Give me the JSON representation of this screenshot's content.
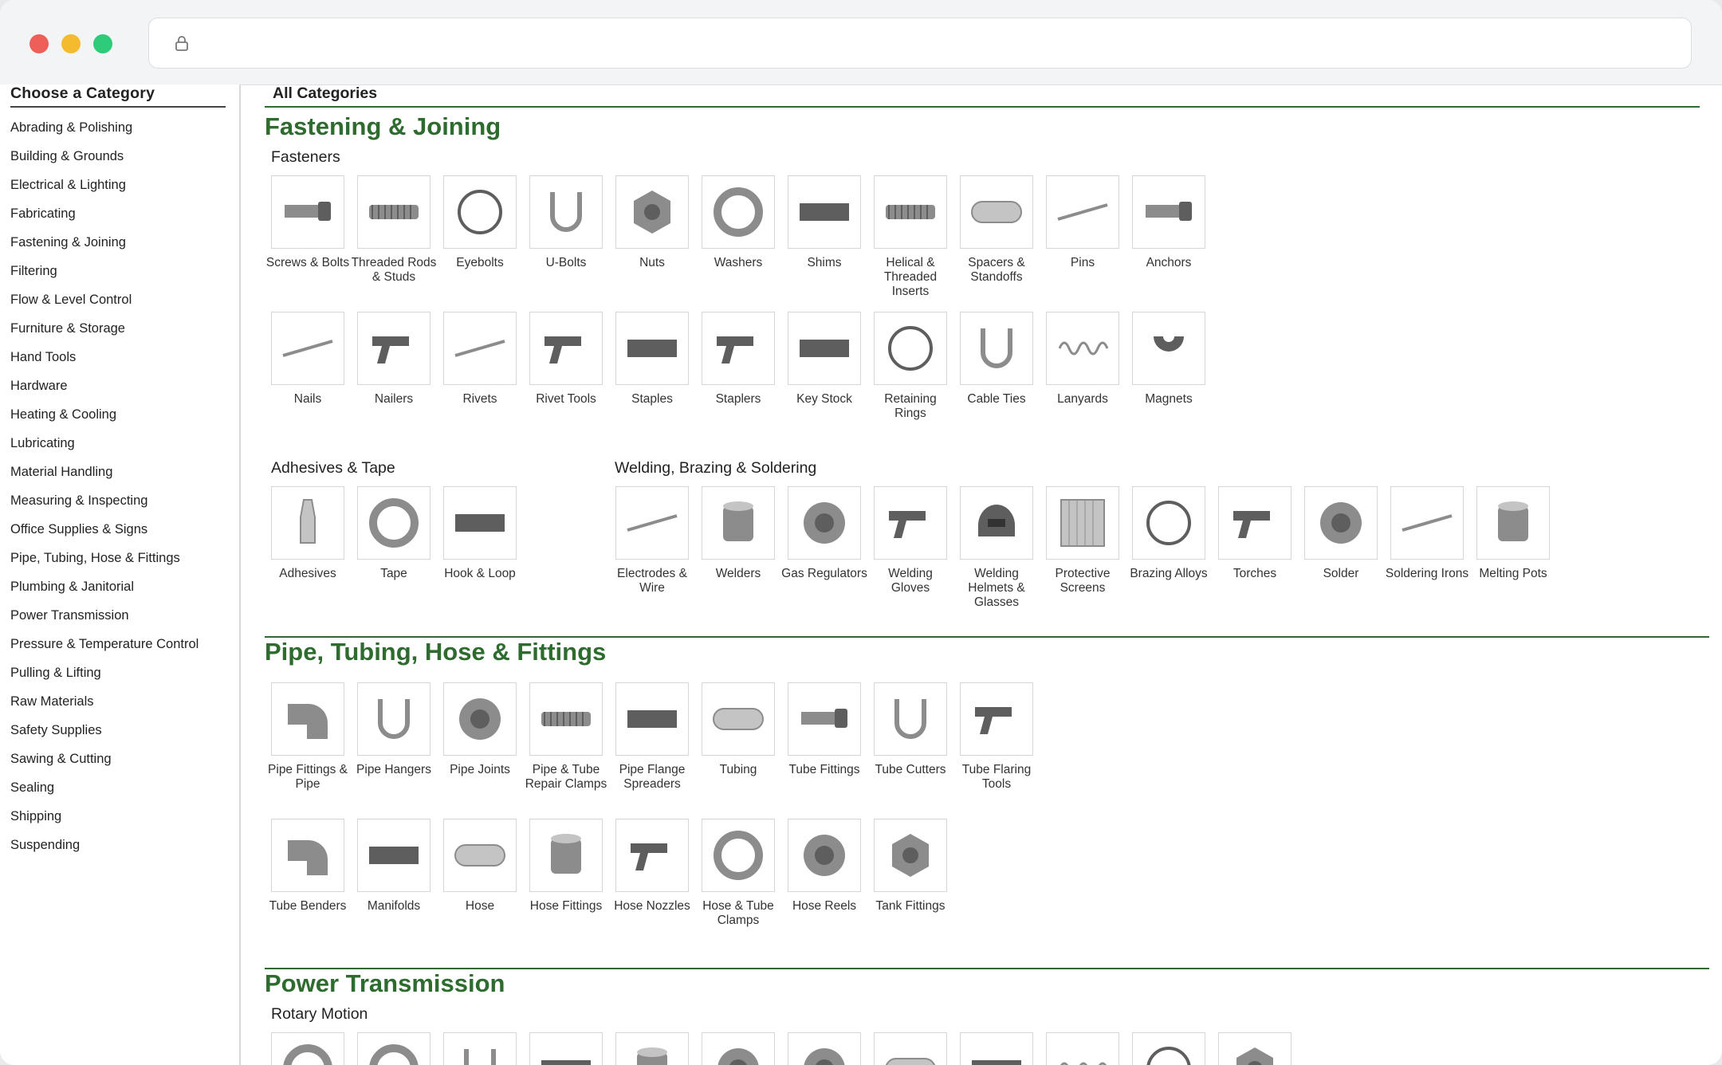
{
  "browser": {
    "url": ""
  },
  "sidebar": {
    "title": "Choose a Category",
    "items": [
      "Abrading & Polishing",
      "Building & Grounds",
      "Electrical & Lighting",
      "Fabricating",
      "Fastening & Joining",
      "Filtering",
      "Flow & Level Control",
      "Furniture & Storage",
      "Hand Tools",
      "Hardware",
      "Heating & Cooling",
      "Lubricating",
      "Material Handling",
      "Measuring & Inspecting",
      "Office Supplies & Signs",
      "Pipe, Tubing, Hose & Fittings",
      "Plumbing & Janitorial",
      "Power Transmission",
      "Pressure & Temperature Control",
      "Pulling & Lifting",
      "Raw Materials",
      "Safety Supplies",
      "Sawing & Cutting",
      "Sealing",
      "Shipping",
      "Suspending"
    ]
  },
  "main": {
    "heading": "All Categories",
    "sections": [
      {
        "title": "Fastening & Joining",
        "groups": [
          {
            "title": "Fasteners",
            "items": [
              {
                "label": "Screws & Bolts",
                "icon": "screw-icon"
              },
              {
                "label": "Threaded Rods & Studs",
                "icon": "threaded-rod-icon"
              },
              {
                "label": "Eyebolts",
                "icon": "eyebolt-icon"
              },
              {
                "label": "U-Bolts",
                "icon": "u-bolt-icon"
              },
              {
                "label": "Nuts",
                "icon": "nut-icon"
              },
              {
                "label": "Washers",
                "icon": "washer-icon"
              },
              {
                "label": "Shims",
                "icon": "shim-icon"
              },
              {
                "label": "Helical & Threaded Inserts",
                "icon": "helical-insert-icon"
              },
              {
                "label": "Spacers & Standoffs",
                "icon": "spacer-icon"
              },
              {
                "label": "Pins",
                "icon": "pin-icon"
              },
              {
                "label": "Anchors",
                "icon": "anchor-icon"
              },
              {
                "label": "Nails",
                "icon": "nail-icon"
              },
              {
                "label": "Nailers",
                "icon": "nailer-icon"
              },
              {
                "label": "Rivets",
                "icon": "rivet-icon"
              },
              {
                "label": "Rivet Tools",
                "icon": "rivet-tool-icon"
              },
              {
                "label": "Staples",
                "icon": "staples-icon"
              },
              {
                "label": "Staplers",
                "icon": "stapler-icon"
              },
              {
                "label": "Key Stock",
                "icon": "key-stock-icon"
              },
              {
                "label": "Retaining Rings",
                "icon": "retaining-ring-icon"
              },
              {
                "label": "Cable Ties",
                "icon": "cable-tie-icon"
              },
              {
                "label": "Lanyards",
                "icon": "lanyard-icon"
              },
              {
                "label": "Magnets",
                "icon": "magnet-icon"
              }
            ]
          },
          {
            "title": "Adhesives & Tape",
            "items": [
              {
                "label": "Adhesives",
                "icon": "adhesive-icon"
              },
              {
                "label": "Tape",
                "icon": "tape-icon"
              },
              {
                "label": "Hook & Loop",
                "icon": "hook-loop-icon"
              }
            ]
          },
          {
            "title": "Welding, Brazing & Soldering",
            "items": [
              {
                "label": "Electrodes & Wire",
                "icon": "electrode-icon"
              },
              {
                "label": "Welders",
                "icon": "welder-icon"
              },
              {
                "label": "Gas Regulators",
                "icon": "gas-regulator-icon"
              },
              {
                "label": "Welding Gloves",
                "icon": "glove-icon"
              },
              {
                "label": "Welding Helmets & Glasses",
                "icon": "welding-helmet-icon"
              },
              {
                "label": "Protective Screens",
                "icon": "screen-icon"
              },
              {
                "label": "Brazing Alloys",
                "icon": "brazing-alloy-icon"
              },
              {
                "label": "Torches",
                "icon": "torch-icon"
              },
              {
                "label": "Solder",
                "icon": "solder-icon"
              },
              {
                "label": "Soldering Irons",
                "icon": "soldering-iron-icon"
              },
              {
                "label": "Melting Pots",
                "icon": "melting-pot-icon"
              }
            ]
          }
        ]
      },
      {
        "title": "Pipe, Tubing, Hose & Fittings",
        "groups": [
          {
            "title": "",
            "items": [
              {
                "label": "Pipe Fittings & Pipe",
                "icon": "pipe-fitting-icon"
              },
              {
                "label": "Pipe Hangers",
                "icon": "pipe-hanger-icon"
              },
              {
                "label": "Pipe Joints",
                "icon": "pipe-joint-icon"
              },
              {
                "label": "Pipe & Tube Repair Clamps",
                "icon": "repair-clamp-icon"
              },
              {
                "label": "Pipe Flange Spreaders",
                "icon": "flange-spreader-icon"
              },
              {
                "label": "Tubing",
                "icon": "tubing-icon"
              },
              {
                "label": "Tube Fittings",
                "icon": "tube-fitting-icon"
              },
              {
                "label": "Tube Cutters",
                "icon": "tube-cutter-icon"
              },
              {
                "label": "Tube Flaring Tools",
                "icon": "flaring-tool-icon"
              },
              {
                "label": "Tube Benders",
                "icon": "tube-bender-icon"
              },
              {
                "label": "Manifolds",
                "icon": "manifold-icon"
              },
              {
                "label": "Hose",
                "icon": "hose-icon"
              },
              {
                "label": "Hose Fittings",
                "icon": "hose-fitting-icon"
              },
              {
                "label": "Hose Nozzles",
                "icon": "hose-nozzle-icon"
              },
              {
                "label": "Hose & Tube Clamps",
                "icon": "hose-clamp-icon"
              },
              {
                "label": "Hose Reels",
                "icon": "hose-reel-icon"
              },
              {
                "label": "Tank Fittings",
                "icon": "tank-fitting-icon"
              }
            ]
          }
        ]
      },
      {
        "title": "Power Transmission",
        "groups": [
          {
            "title": "Rotary Motion",
            "items": [
              {
                "label": "",
                "icon": "bearing-icon"
              },
              {
                "label": "",
                "icon": "bushing-icon"
              },
              {
                "label": "",
                "icon": "puller-icon"
              },
              {
                "label": "",
                "icon": "pillow-block-icon"
              },
              {
                "label": "",
                "icon": "gear-reducer-icon"
              },
              {
                "label": "",
                "icon": "coupling-icon"
              },
              {
                "label": "",
                "icon": "pulley-icon"
              },
              {
                "label": "",
                "icon": "shaft-icon"
              },
              {
                "label": "",
                "icon": "linear-rail-icon"
              },
              {
                "label": "",
                "icon": "chain-icon"
              },
              {
                "label": "",
                "icon": "belt-icon"
              },
              {
                "label": "",
                "icon": "sprocket-icon"
              }
            ]
          }
        ]
      }
    ]
  }
}
